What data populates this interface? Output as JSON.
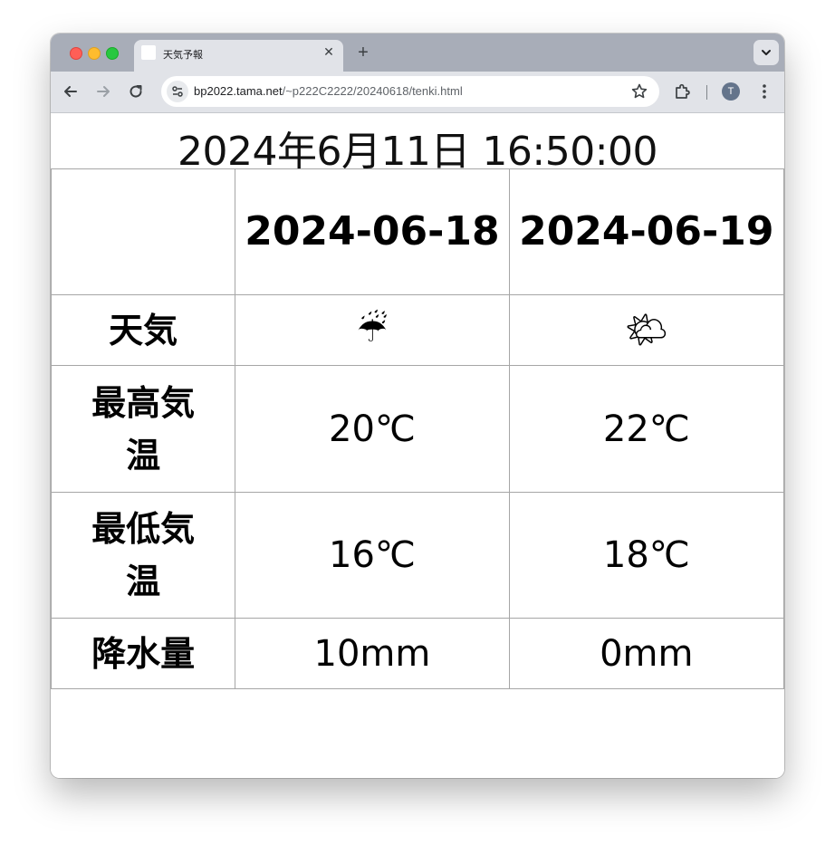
{
  "browser": {
    "tab_title": "天気予報",
    "url_host": "bp2022.tama.net",
    "url_path": "/~p222C2222/20240618/tenki.html",
    "avatar_letter": "T"
  },
  "page": {
    "datetime": "2024年6月11日 16:50:00",
    "dates": [
      "2024-06-18",
      "2024-06-19"
    ],
    "rows": {
      "weather_label": "天気",
      "weather_icons": [
        "☔",
        "🌤"
      ],
      "weather_icon_names": [
        "umbrella-rain-icon",
        "sun-behind-cloud-icon"
      ],
      "max_label": "最高気温",
      "max_values": [
        "20℃",
        "22℃"
      ],
      "min_label": "最低気温",
      "min_values": [
        "16℃",
        "18℃"
      ],
      "precip_label": "降水量",
      "precip_values": [
        "10mm",
        "0mm"
      ]
    }
  }
}
